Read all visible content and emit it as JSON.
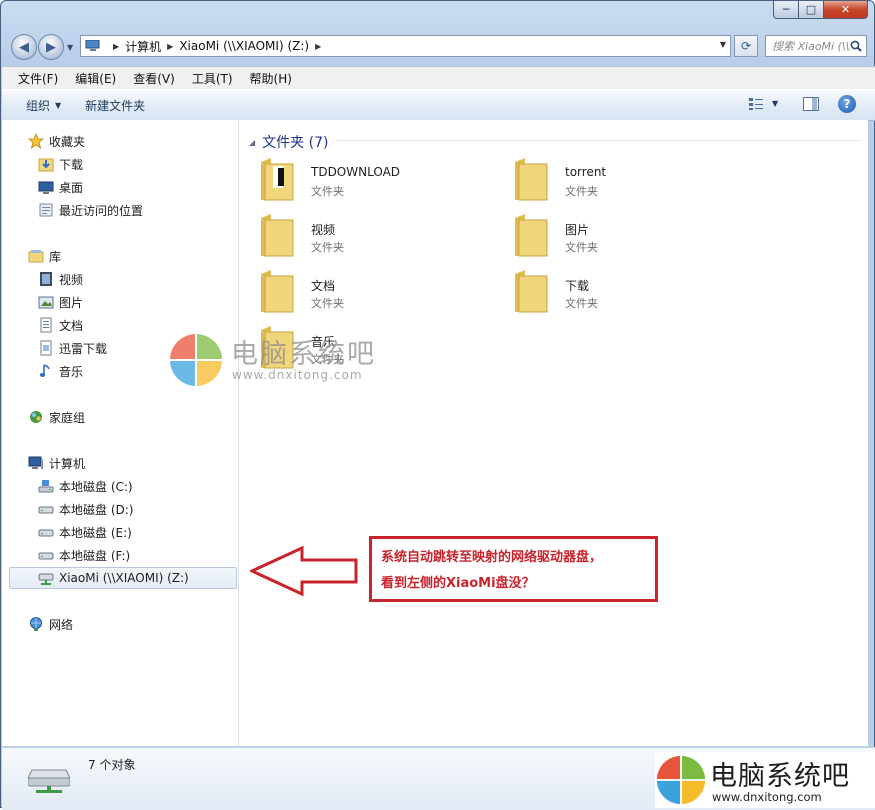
{
  "window": {
    "caption": {
      "minimize": "─",
      "maximize": "□",
      "close": "✕"
    }
  },
  "address_bar": {
    "segments": [
      "计算机",
      "XiaoMi (\\\\XIAOMI) (Z:)"
    ],
    "search_placeholder": "搜索 XiaoMi (\\\\XIAOMI) (Z:)"
  },
  "menu": [
    "文件(F)",
    "编辑(E)",
    "查看(V)",
    "工具(T)",
    "帮助(H)"
  ],
  "toolbar": {
    "organize": "组织",
    "new_folder": "新建文件夹",
    "help": "?"
  },
  "nav_pane": {
    "favorites": {
      "label": "收藏夹",
      "items": [
        "下载",
        "桌面",
        "最近访问的位置"
      ]
    },
    "libraries": {
      "label": "库",
      "items": [
        "视频",
        "图片",
        "文档",
        "迅雷下载",
        "音乐"
      ]
    },
    "homegroup": "家庭组",
    "computer": {
      "label": "计算机",
      "items": [
        "本地磁盘 (C:)",
        "本地磁盘 (D:)",
        "本地磁盘 (E:)",
        "本地磁盘 (F:)",
        "XiaoMi (\\\\XIAOMI) (Z:)"
      ]
    },
    "network": "网络"
  },
  "content": {
    "group_label": "文件夹 (7)",
    "items": [
      {
        "name": "TDDOWNLOAD",
        "type": "文件夹"
      },
      {
        "name": "torrent",
        "type": "文件夹"
      },
      {
        "name": "视频",
        "type": "文件夹"
      },
      {
        "name": "图片",
        "type": "文件夹"
      },
      {
        "name": "文档",
        "type": "文件夹"
      },
      {
        "name": "下载",
        "type": "文件夹"
      },
      {
        "name": "音乐",
        "type": "文件夹"
      }
    ]
  },
  "status": {
    "count": "7 个对象"
  },
  "annotation": {
    "line1": "系统自动跳转至映射的网络驱动器盘，",
    "line2": "看到左侧的XiaoMi盘没？",
    "color": "#c7242c"
  },
  "watermark": {
    "name": "电脑系统吧",
    "url": "www.dnxitong.com"
  },
  "colors": {
    "folder": "#f2d67c",
    "accent": "#1e3287"
  }
}
